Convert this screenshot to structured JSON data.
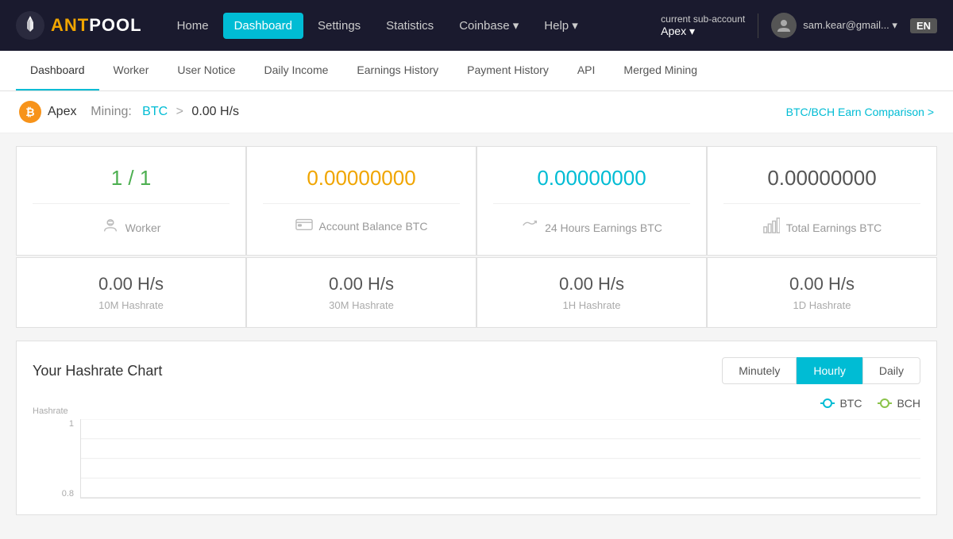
{
  "nav": {
    "logo_ant": "ANT",
    "logo_pool": "POOL",
    "links": [
      {
        "label": "Home",
        "active": false
      },
      {
        "label": "Dashboard",
        "active": true
      },
      {
        "label": "Settings",
        "active": false
      },
      {
        "label": "Statistics",
        "active": false
      },
      {
        "label": "Coinbase ▾",
        "active": false
      },
      {
        "label": "Help ▾",
        "active": false
      }
    ],
    "sub_account_label": "current sub-account",
    "account_name": "Apex ▾",
    "user_email": "sam.kear@gmail... ▾",
    "lang": "EN"
  },
  "sub_nav": {
    "items": [
      {
        "label": "Dashboard",
        "active": true
      },
      {
        "label": "Worker",
        "active": false
      },
      {
        "label": "User Notice",
        "active": false
      },
      {
        "label": "Daily Income",
        "active": false
      },
      {
        "label": "Earnings History",
        "active": false
      },
      {
        "label": "Payment History",
        "active": false
      },
      {
        "label": "API",
        "active": false
      },
      {
        "label": "Merged Mining",
        "active": false
      }
    ]
  },
  "breadcrumb": {
    "account": "Apex",
    "mining_label": "Mining:",
    "btc_label": "BTC",
    "separator": ">",
    "hashrate": "0.00 H/s",
    "comparison_link": "BTC/BCH Earn Comparison >"
  },
  "stats": {
    "worker": {
      "value": "1 / 1",
      "label": "Worker",
      "color": "green"
    },
    "balance": {
      "value": "0.00000000",
      "label": "Account Balance BTC",
      "color": "orange"
    },
    "earnings24h": {
      "value": "0.00000000",
      "label": "24 Hours Earnings BTC",
      "color": "teal"
    },
    "total": {
      "value": "0.00000000",
      "label": "Total Earnings BTC",
      "color": "dark"
    }
  },
  "hashrates": [
    {
      "value": "0.00 H/s",
      "label": "10M Hashrate"
    },
    {
      "value": "0.00 H/s",
      "label": "30M Hashrate"
    },
    {
      "value": "0.00 H/s",
      "label": "1H Hashrate"
    },
    {
      "value": "0.00 H/s",
      "label": "1D Hashrate"
    }
  ],
  "chart": {
    "title": "Your Hashrate Chart",
    "buttons": [
      {
        "label": "Minutely",
        "active": false
      },
      {
        "label": "Hourly",
        "active": true
      },
      {
        "label": "Daily",
        "active": false
      }
    ],
    "legend": [
      {
        "label": "BTC",
        "type": "btc"
      },
      {
        "label": "BCH",
        "type": "bch"
      }
    ],
    "y_axis_title": "Hashrate",
    "y_labels": [
      "1",
      "0.8"
    ]
  }
}
